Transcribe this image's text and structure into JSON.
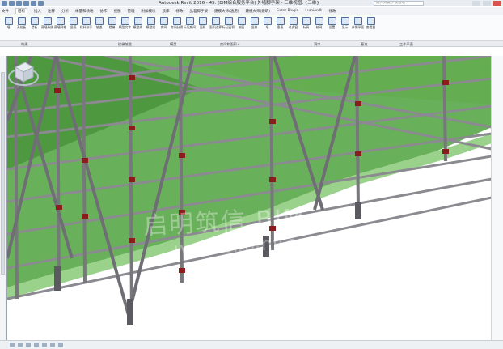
{
  "window": {
    "title": "Autodesk Revit 2016 -    45. (BIM综合服务平台) 外墙脚手架 - 三维视图: {三维}",
    "search_placeholder": "键入关键字或短语"
  },
  "tabs": [
    {
      "label": "文件"
    },
    {
      "label": "结构"
    },
    {
      "label": "插入"
    },
    {
      "label": "注释"
    },
    {
      "label": "分析"
    },
    {
      "label": "体量和场地"
    },
    {
      "label": "协作"
    },
    {
      "label": "视图"
    },
    {
      "label": "管理"
    },
    {
      "label": "附加模块"
    },
    {
      "label": "族库"
    },
    {
      "label": "修改"
    },
    {
      "label": "品茗脚手架"
    },
    {
      "label": "建模大师(通用)"
    },
    {
      "label": "建模大师(建筑)"
    },
    {
      "label": "Fuzor Plugin"
    },
    {
      "label": "Lumion®"
    },
    {
      "label": "修改"
    }
  ],
  "ribbon": {
    "tools": [
      {
        "label": "墙"
      },
      {
        "label": "天花板"
      },
      {
        "label": "楼板"
      },
      {
        "label": "幕墙系统"
      },
      {
        "label": "幕墙网格"
      },
      {
        "label": "竖梃"
      },
      {
        "label": "栏杆扶手"
      },
      {
        "label": "坡道"
      },
      {
        "label": "楼梯"
      },
      {
        "label": "模型文字"
      },
      {
        "label": "模型线"
      },
      {
        "label": "模型组"
      },
      {
        "label": "房间"
      },
      {
        "label": "房间分隔"
      },
      {
        "label": "标记房间"
      },
      {
        "label": "面积"
      },
      {
        "label": "面积边界"
      },
      {
        "label": "标记面积"
      },
      {
        "label": "按面"
      },
      {
        "label": "竖井"
      },
      {
        "label": "墙"
      },
      {
        "label": "垂直"
      },
      {
        "label": "老虎窗"
      },
      {
        "label": "标高"
      },
      {
        "label": "轴网"
      },
      {
        "label": "设置"
      },
      {
        "label": "显示"
      },
      {
        "label": "参照平面"
      },
      {
        "label": "查看器"
      }
    ],
    "panels": [
      {
        "label": "构建"
      },
      {
        "label": "楼梯坡道"
      },
      {
        "label": "模型"
      },
      {
        "label": "房间和面积 ▾"
      },
      {
        "label": "洞口"
      },
      {
        "label": "基准"
      },
      {
        "label": "工作平面"
      }
    ]
  },
  "viewport": {
    "watermark_line1": "启明筑信 BIM",
    "watermark_line2": "www.bimmy.com"
  },
  "colors": {
    "glass": "#3f9a2b",
    "pipe": "#7e7e82",
    "coupler": "#8a1c1c",
    "ribbon_bg": "#fafbfc"
  },
  "icons": {
    "nav_cube": "nav-cube-icon"
  }
}
